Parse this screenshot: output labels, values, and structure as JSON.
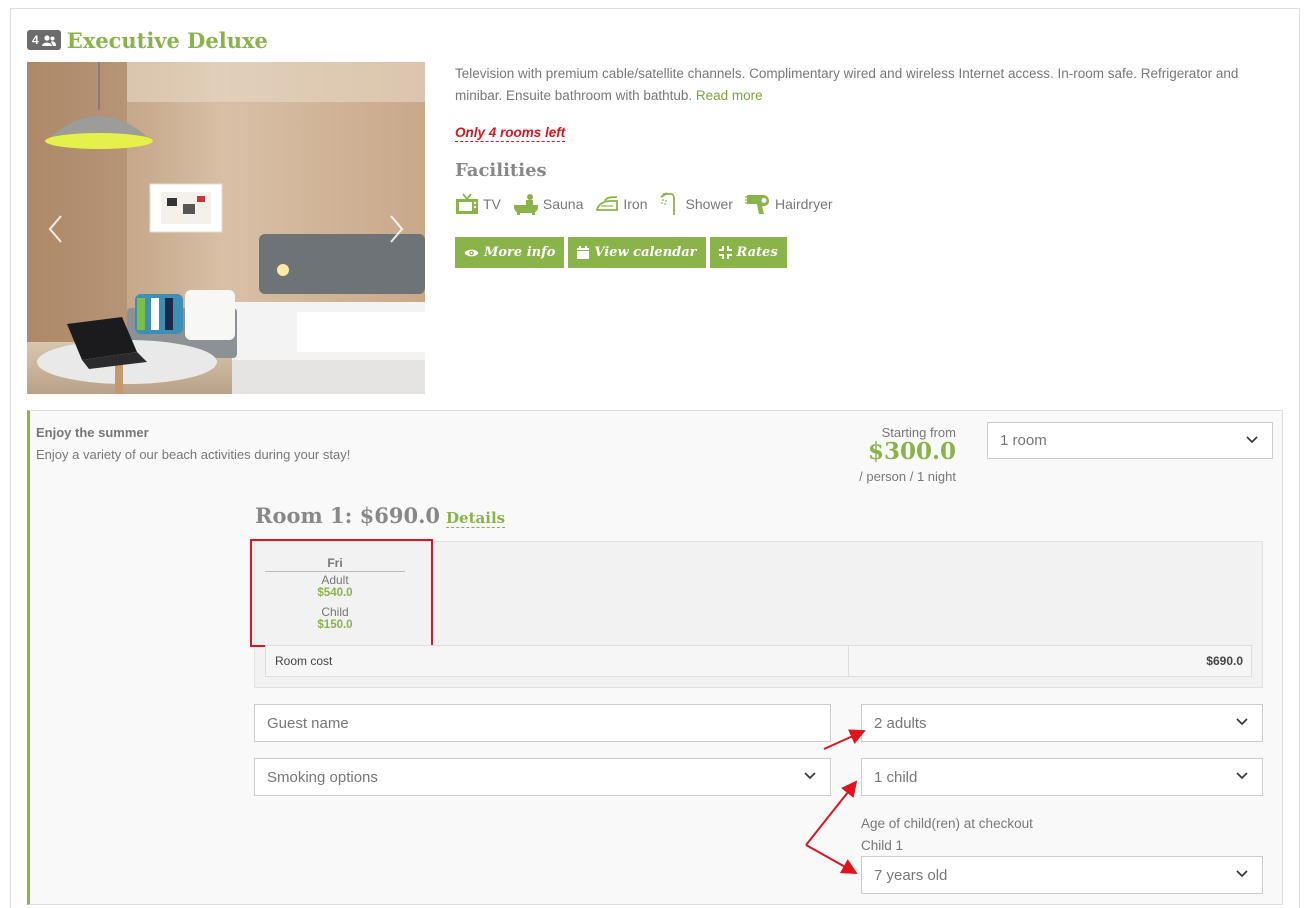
{
  "room": {
    "occupancy_badge": "4",
    "title": "Executive Deluxe",
    "description": "Television with premium cable/satellite channels. Complimentary wired and wireless Internet access. In-room safe. Refrigerator and minibar. Ensuite bathroom with bathtub.",
    "read_more": "Read more",
    "availability": "Only 4 rooms left",
    "facilities_title": "Facilities",
    "facilities": [
      {
        "label": "TV",
        "icon": "tv-icon"
      },
      {
        "label": "Sauna",
        "icon": "bathtub-icon"
      },
      {
        "label": "Iron",
        "icon": "iron-icon"
      },
      {
        "label": "Shower",
        "icon": "shower-icon"
      },
      {
        "label": "Hairdryer",
        "icon": "hairdryer-icon"
      }
    ],
    "buttons": {
      "more_info": "More info",
      "view_calendar": "View calendar",
      "rates": "Rates"
    }
  },
  "offer": {
    "title": "Enjoy the summer",
    "subtitle": "Enjoy a variety of our beach activities during your stay!",
    "starting_from": "Starting from",
    "price": "$300.0",
    "per": "/ person / 1 night",
    "rooms_select": "1 room"
  },
  "room1": {
    "title": "Room 1: $690.0",
    "details": "Details",
    "day": "Fri",
    "adult_label": "Adult",
    "adult_price": "$540.0",
    "child_label": "Child",
    "child_price": "$150.0",
    "cost_label": "Room cost",
    "cost_value": "$690.0"
  },
  "form": {
    "guest_placeholder": "Guest name",
    "smoking": "Smoking options",
    "adults": "2 adults",
    "children": "1 child",
    "age_label": "Age of child(ren) at checkout",
    "child1_label": "Child 1",
    "child1_age": "7 years old"
  },
  "colors": {
    "accent": "#8ab34a",
    "alert": "#e0141e"
  }
}
